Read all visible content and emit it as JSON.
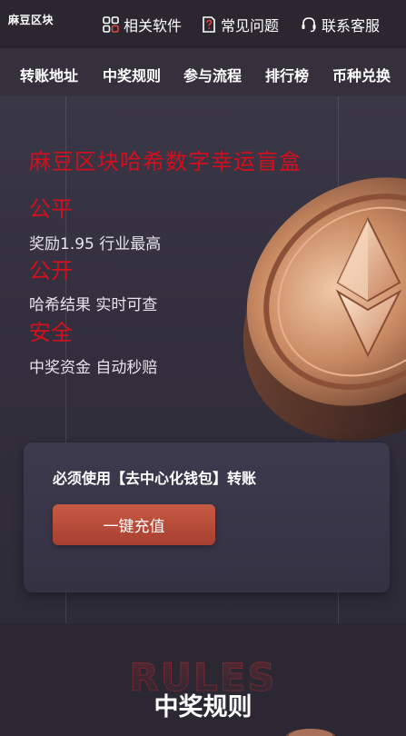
{
  "header": {
    "logo": "麻豆区块",
    "links": [
      {
        "label": "相关软件",
        "icon": "apps-grid-icon"
      },
      {
        "label": "常见问题",
        "icon": "question-doc-icon"
      },
      {
        "label": "联系客服",
        "icon": "headset-icon"
      }
    ]
  },
  "nav": {
    "items": [
      "转账地址",
      "中奖规则",
      "参与流程",
      "排行榜",
      "币种兑换"
    ]
  },
  "hero": {
    "title": "麻豆区块哈希数字幸运盲盒",
    "features": [
      {
        "title": "公平",
        "desc": "奖励1.95 行业最高"
      },
      {
        "title": "公开",
        "desc": "哈希结果 实时可查"
      },
      {
        "title": "安全",
        "desc": "中奖资金 自动秒赔"
      }
    ],
    "image": "ethereum-coin"
  },
  "deposit": {
    "notice": "必须使用【去中心化钱包】转账",
    "button": "一键充值"
  },
  "rules": {
    "bg_word": "RULES",
    "title": "中奖规则"
  },
  "colors": {
    "accent_red": "#d40f1d",
    "button": "#b84a3a",
    "background": "#2b2833"
  }
}
